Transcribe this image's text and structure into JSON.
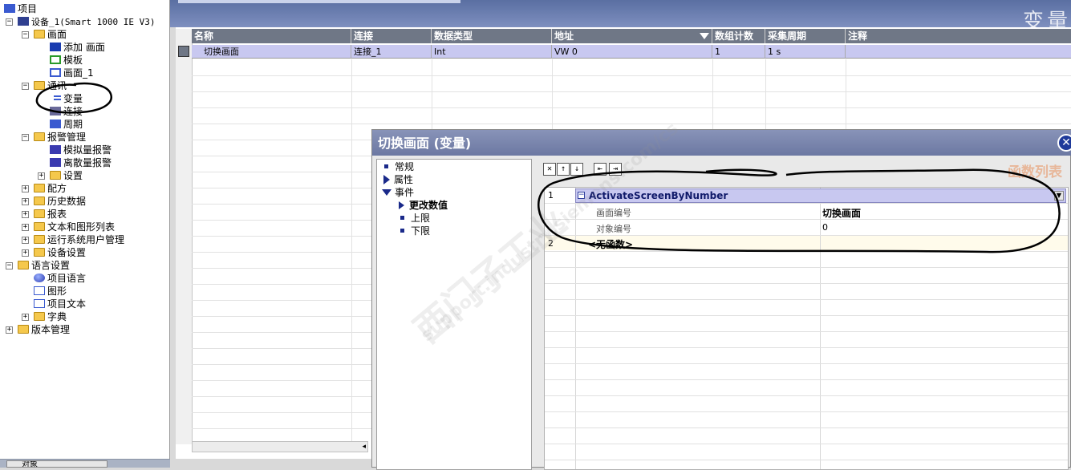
{
  "project_tree": {
    "items": [
      {
        "label": "项目",
        "icon": "project-icon",
        "level": 0
      },
      {
        "label": "设备_1(Smart 1000 IE V3)",
        "icon": "device-icon",
        "level": 0
      },
      {
        "label": "画面",
        "icon": "folder-icon",
        "level": 1
      },
      {
        "label": "添加 画面",
        "icon": "add-screen-icon",
        "level": 2
      },
      {
        "label": "模板",
        "icon": "template-icon",
        "level": 2
      },
      {
        "label": "画面_1",
        "icon": "screen-icon",
        "level": 2
      },
      {
        "label": "通讯",
        "icon": "folder-icon",
        "level": 1
      },
      {
        "label": "变量",
        "icon": "tags-icon",
        "level": 2
      },
      {
        "label": "连接",
        "icon": "connection-icon",
        "level": 2
      },
      {
        "label": "周期",
        "icon": "cycle-icon",
        "level": 2
      },
      {
        "label": "报警管理",
        "icon": "folder-icon",
        "level": 1
      },
      {
        "label": "模拟量报警",
        "icon": "analog-alarm-icon",
        "level": 2
      },
      {
        "label": "离散量报警",
        "icon": "discrete-alarm-icon",
        "level": 2
      },
      {
        "label": "设置",
        "icon": "folder-icon",
        "level": 2
      },
      {
        "label": "配方",
        "icon": "folder-icon",
        "level": 1
      },
      {
        "label": "历史数据",
        "icon": "folder-icon",
        "level": 1
      },
      {
        "label": "报表",
        "icon": "folder-icon",
        "level": 1
      },
      {
        "label": "文本和图形列表",
        "icon": "folder-icon",
        "level": 1
      },
      {
        "label": "运行系统用户管理",
        "icon": "folder-icon",
        "level": 1
      },
      {
        "label": "设备设置",
        "icon": "folder-icon",
        "level": 1
      },
      {
        "label": "语言设置",
        "icon": "folder-icon",
        "level": 0
      },
      {
        "label": "项目语言",
        "icon": "globe-icon",
        "level": 1
      },
      {
        "label": "图形",
        "icon": "graphics-icon",
        "level": 1
      },
      {
        "label": "项目文本",
        "icon": "text-icon",
        "level": 1
      },
      {
        "label": "字典",
        "icon": "folder-icon",
        "level": 1
      },
      {
        "label": "版本管理",
        "icon": "folder-icon",
        "level": 0
      }
    ]
  },
  "bottom_tab": {
    "label": "对象"
  },
  "workspace": {
    "title_watermark": "变量"
  },
  "tag_table": {
    "columns": [
      "名称",
      "连接",
      "数据类型",
      "地址",
      "数组计数",
      "采集周期",
      "注释"
    ],
    "rows": [
      {
        "name": "切换画面",
        "connection": "连接_1",
        "type": "Int",
        "address": "VW 0",
        "array_count": "1",
        "cycle": "1 s",
        "comment": ""
      }
    ]
  },
  "dialog": {
    "title": "切换画面 (变量)",
    "nav": {
      "general": "常规",
      "properties": "属性",
      "events": "事件",
      "value_change": "更改数值",
      "upper_limit": "上限",
      "lower_limit": "下限"
    },
    "function_list_title": "函数列表",
    "functions": [
      {
        "index": "1",
        "name": "ActivateScreenByNumber",
        "params": [
          {
            "label": "画面编号",
            "value": "切换画面"
          },
          {
            "label": "对象编号",
            "value": "0"
          }
        ]
      },
      {
        "index": "2",
        "name": "<无函数>"
      }
    ]
  },
  "watermark": {
    "line1": "西门子工业",
    "line2": "support.industry.siemens.com/cs"
  },
  "colors": {
    "selection": "#c8c8f0",
    "header": "#6f7786",
    "dialog_title": "#6c78a2",
    "function_title": "#e8b79a"
  }
}
